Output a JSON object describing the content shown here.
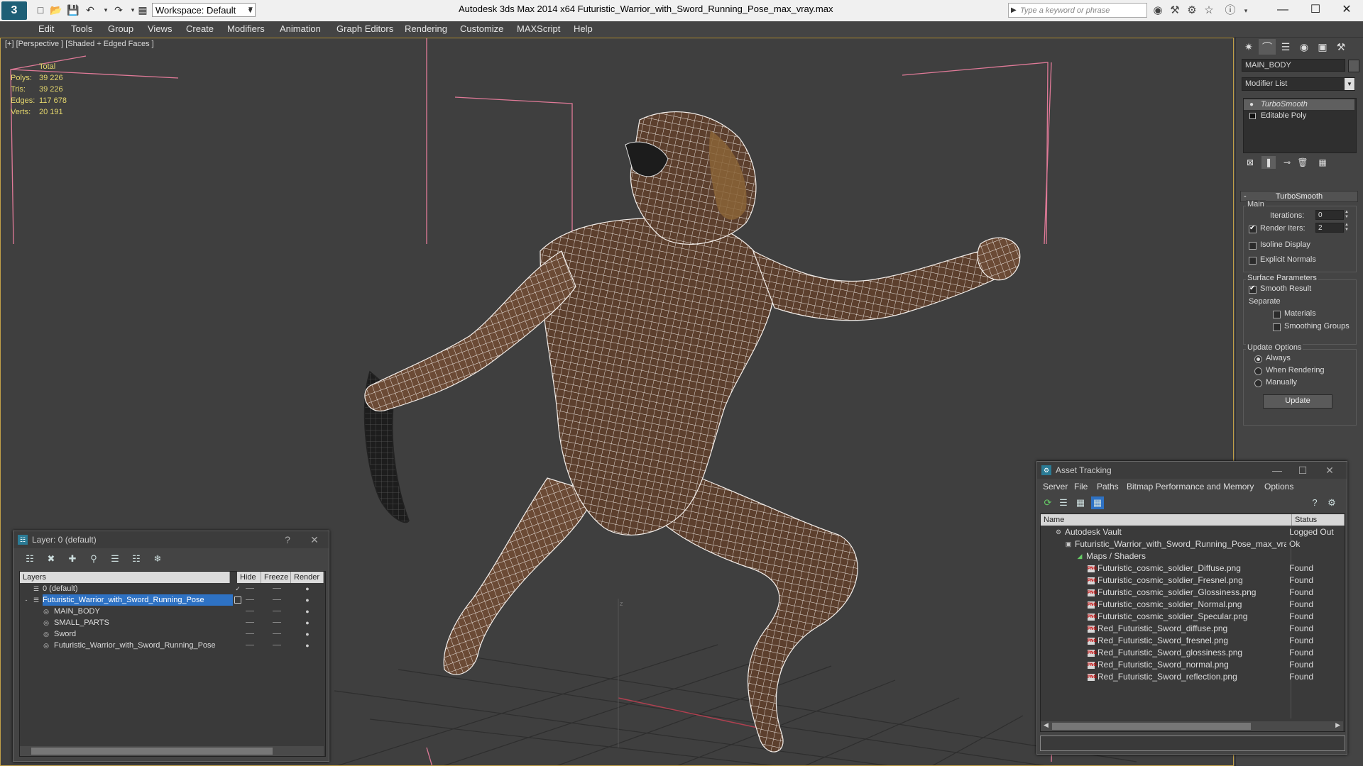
{
  "titlebar": {
    "app_title": "Autodesk 3ds Max  2014 x64       Futuristic_Warrior_with_Sword_Running_Pose_max_vray.max",
    "workspace_label": "Workspace: Default",
    "search_placeholder": "Type a keyword or phrase"
  },
  "menu": [
    "Edit",
    "Tools",
    "Group",
    "Views",
    "Create",
    "Modifiers",
    "Animation",
    "Graph Editors",
    "Rendering",
    "Customize",
    "MAXScript",
    "Help"
  ],
  "viewport": {
    "label": "[+] [Perspective ] [Shaded + Edged Faces ]",
    "stats": {
      "header": "Total",
      "rows": [
        {
          "label": "Polys:",
          "value": "39 226"
        },
        {
          "label": "Tris:",
          "value": "39 226"
        },
        {
          "label": "Edges:",
          "value": "117 678"
        },
        {
          "label": "Verts:",
          "value": "20 191"
        }
      ]
    },
    "axis_label": "z"
  },
  "command_panel": {
    "object_name": "MAIN_BODY",
    "modifier_list": "Modifier List",
    "stack": [
      "TurboSmooth",
      "Editable Poly"
    ],
    "rollout_title": "TurboSmooth",
    "main_group": "Main",
    "iterations_label": "Iterations:",
    "iterations_value": "0",
    "render_iters_label": "Render Iters:",
    "render_iters_value": "2",
    "isoline_label": "Isoline Display",
    "explicit_normals_label": "Explicit Normals",
    "surface_group": "Surface Parameters",
    "smooth_result_label": "Smooth Result",
    "separate_label": "Separate",
    "materials_label": "Materials",
    "smoothing_groups_label": "Smoothing Groups",
    "update_group": "Update Options",
    "always_label": "Always",
    "when_rendering_label": "When Rendering",
    "manually_label": "Manually",
    "update_button": "Update"
  },
  "layer_window": {
    "title": "Layer: 0 (default)",
    "columns": [
      "Layers",
      "Hide",
      "Freeze",
      "Render"
    ],
    "rows": [
      {
        "name": "0 (default)",
        "indent": 1
      },
      {
        "name": "Futuristic_Warrior_with_Sword_Running_Pose",
        "indent": 1,
        "selected": true
      },
      {
        "name": "MAIN_BODY",
        "indent": 2
      },
      {
        "name": "SMALL_PARTS",
        "indent": 2
      },
      {
        "name": "Sword",
        "indent": 2
      },
      {
        "name": "Futuristic_Warrior_with_Sword_Running_Pose",
        "indent": 2
      }
    ]
  },
  "asset_tracking": {
    "title": "Asset Tracking",
    "menu": [
      "Server",
      "File",
      "Paths",
      "Bitmap Performance and Memory",
      "Options"
    ],
    "columns": [
      "Name",
      "Status"
    ],
    "rows": [
      {
        "name": "Autodesk Vault",
        "status": "Logged Out",
        "indent": 0
      },
      {
        "name": "Futuristic_Warrior_with_Sword_Running_Pose_max_vra...",
        "status": "Ok",
        "indent": 1
      },
      {
        "name": "Maps / Shaders",
        "status": "",
        "indent": 2
      },
      {
        "name": "Futuristic_cosmic_soldier_Diffuse.png",
        "status": "Found",
        "indent": 3
      },
      {
        "name": "Futuristic_cosmic_soldier_Fresnel.png",
        "status": "Found",
        "indent": 3
      },
      {
        "name": "Futuristic_cosmic_soldier_Glossiness.png",
        "status": "Found",
        "indent": 3
      },
      {
        "name": "Futuristic_cosmic_soldier_Normal.png",
        "status": "Found",
        "indent": 3
      },
      {
        "name": "Futuristic_cosmic_soldier_Specular.png",
        "status": "Found",
        "indent": 3
      },
      {
        "name": "Red_Futuristic_Sword_diffuse.png",
        "status": "Found",
        "indent": 3
      },
      {
        "name": "Red_Futuristic_Sword_fresnel.png",
        "status": "Found",
        "indent": 3
      },
      {
        "name": "Red_Futuristic_Sword_glossiness.png",
        "status": "Found",
        "indent": 3
      },
      {
        "name": "Red_Futuristic_Sword_normal.png",
        "status": "Found",
        "indent": 3
      },
      {
        "name": "Red_Futuristic_Sword_reflection.png",
        "status": "Found",
        "indent": 3
      }
    ]
  },
  "colors": {
    "viewport_bg": "#3f3f3f",
    "stats_text": "#e6d86d",
    "selection": "#2e72c4",
    "bounding_box": "#e07a98",
    "wire": "#ffffff",
    "skin": "#6b4a35"
  }
}
